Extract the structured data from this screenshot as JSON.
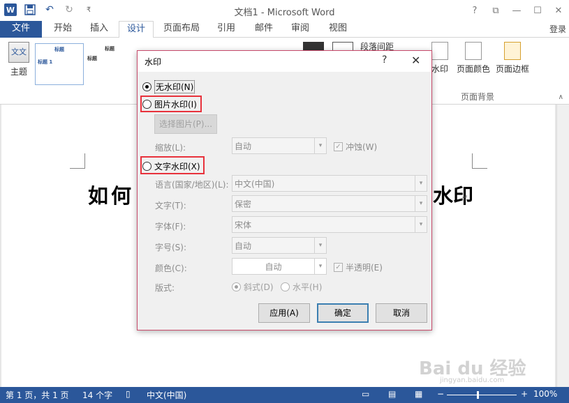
{
  "titlebar": {
    "title": "文档1 - Microsoft Word",
    "word_logo": "W",
    "help": "?",
    "ribbon_opts": "⧉",
    "minimize": "—",
    "maximize": "☐",
    "close": "✕",
    "login": "登录"
  },
  "qat": {
    "undo": "↶",
    "redo": "↻",
    "customize": "₹"
  },
  "tabs": [
    "文件",
    "开始",
    "插入",
    "设计",
    "页面布局",
    "引用",
    "邮件",
    "审阅",
    "视图"
  ],
  "ribbon": {
    "theme_label": "主题",
    "theme_icon_text": "文文",
    "gallery_title": "标题",
    "gallery_heading": "标题 1",
    "para_spacing": "段落间距",
    "watermark_btn": "水印",
    "page_color": "页面颜色",
    "page_border": "页面边框",
    "group_label": "页面背景"
  },
  "document": {
    "text_left": "如何",
    "text_right": "水印",
    "para_mark": "↵"
  },
  "dialog": {
    "title": "水印",
    "help": "?",
    "close": "✕",
    "no_watermark": "无水印(N)",
    "picture_watermark": "图片水印(I)",
    "select_picture": "选择图片(P)...",
    "scale_label": "缩放(L):",
    "scale_value": "自动",
    "washout": "冲蚀(W)",
    "text_watermark": "文字水印(X)",
    "language_label": "语言(国家/地区)(L):",
    "language_value": "中文(中国)",
    "text_label": "文字(T):",
    "text_value": "保密",
    "font_label": "字体(F):",
    "font_value": "宋体",
    "size_label": "字号(S):",
    "size_value": "自动",
    "color_label": "颜色(C):",
    "color_value": "自动",
    "semitransparent": "半透明(E)",
    "layout_label": "版式:",
    "diagonal": "斜式(D)",
    "horizontal": "水平(H)",
    "apply": "应用(A)",
    "ok": "确定",
    "cancel": "取消"
  },
  "statusbar": {
    "page": "第 1 页，共 1 页",
    "words": "14 个字",
    "language": "中文(中国)",
    "zoom": "100%"
  },
  "watermark_site": {
    "main": "Bai du 经验",
    "sub": "jingyan.baidu.com"
  },
  "colors": {
    "accent": "#2b579a",
    "highlight": "#e8323c"
  }
}
